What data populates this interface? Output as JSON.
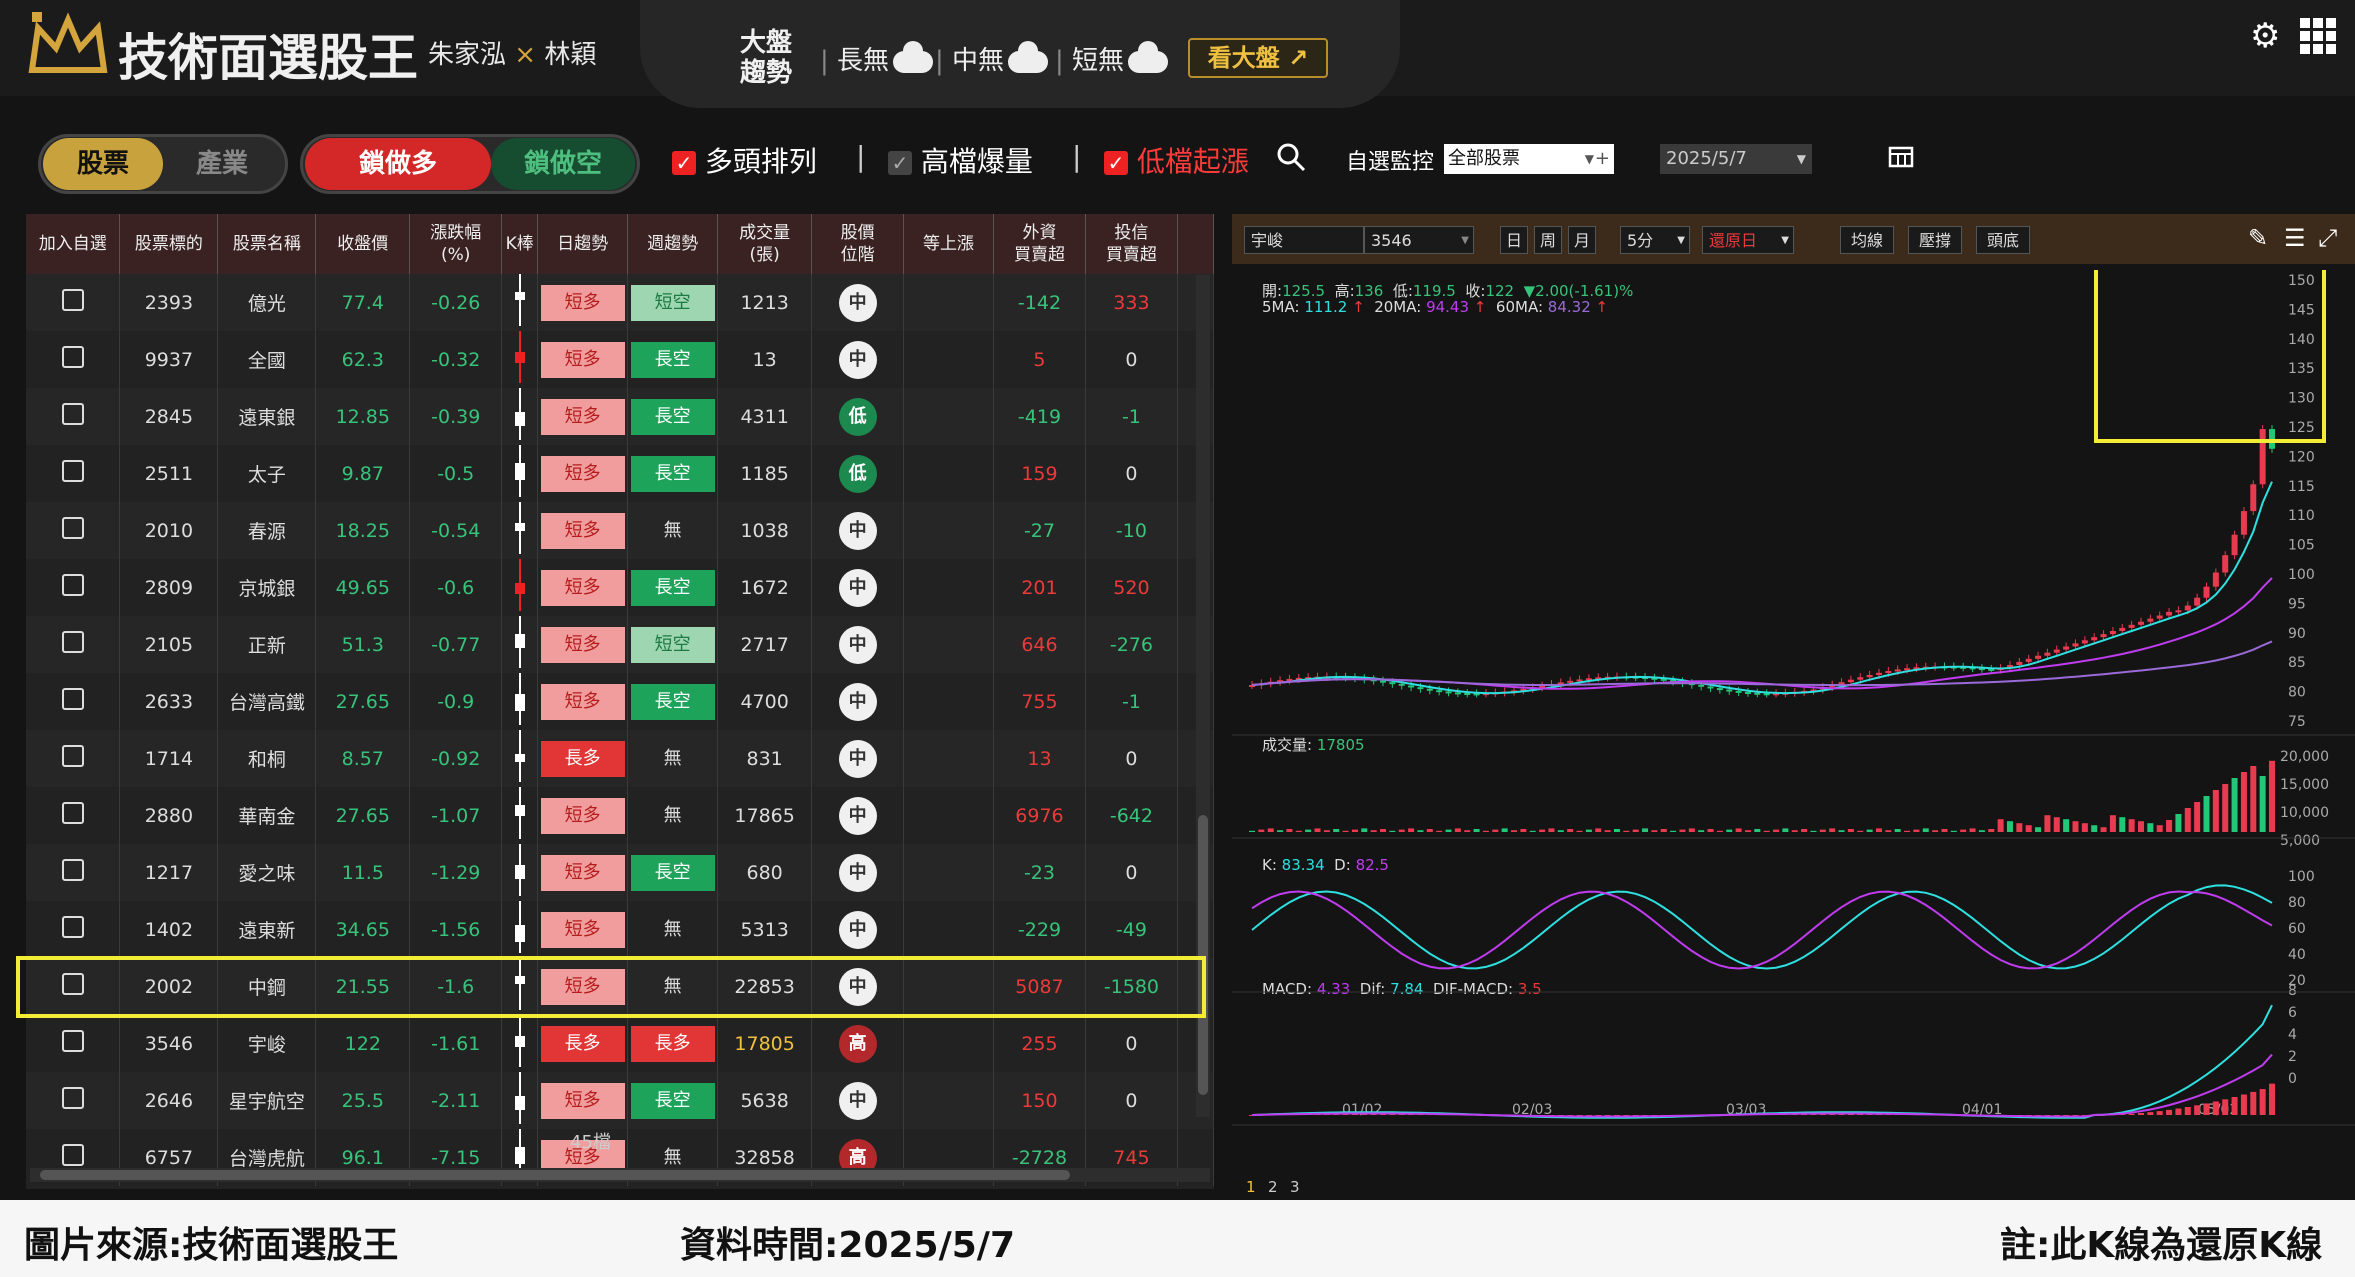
{
  "header": {
    "title": "技術面選股王",
    "author1": "朱家泓",
    "author_sep": "×",
    "author2": "林穎",
    "market_label_top": "大盤",
    "market_label_bottom": "趨勢",
    "long": "長無",
    "mid": "中無",
    "short": "短無",
    "see_market": "看大盤"
  },
  "toolbar": {
    "tab_stock": "股票",
    "tab_industry": "產業",
    "lock_long": "鎖做多",
    "lock_short": "鎖做空",
    "opt1": "多頭排列",
    "opt2": "高檔爆量",
    "opt3": "低檔起漲",
    "watch_label": "自選監控",
    "watch_select": "全部股票",
    "date": "2025/5/7"
  },
  "table": {
    "headers": [
      "加入自選",
      "股票標的",
      "股票名稱",
      "收盤價",
      "漲跌幅\n(%)",
      "K棒",
      "日趨勢",
      "週趨勢",
      "成交量\n(張)",
      "股價\n位階",
      "等上漲",
      "外資\n買賣超",
      "投信\n買賣超"
    ],
    "rows": [
      {
        "code": "2393",
        "name": "億光",
        "close": "77.4",
        "chg": "-0.26",
        "day": "短多",
        "week": "短空",
        "vol": "1213",
        "pos": "中",
        "fi": "-142",
        "it": "333"
      },
      {
        "code": "9937",
        "name": "全國",
        "close": "62.3",
        "chg": "-0.32",
        "day": "短多",
        "week": "長空",
        "vol": "13",
        "pos": "中",
        "fi": "5",
        "it": "0"
      },
      {
        "code": "2845",
        "name": "遠東銀",
        "close": "12.85",
        "chg": "-0.39",
        "day": "短多",
        "week": "長空",
        "vol": "4311",
        "pos": "低",
        "fi": "-419",
        "it": "-1"
      },
      {
        "code": "2511",
        "name": "太子",
        "close": "9.87",
        "chg": "-0.5",
        "day": "短多",
        "week": "長空",
        "vol": "1185",
        "pos": "低",
        "fi": "159",
        "it": "0"
      },
      {
        "code": "2010",
        "name": "春源",
        "close": "18.25",
        "chg": "-0.54",
        "day": "短多",
        "week": "無",
        "vol": "1038",
        "pos": "中",
        "fi": "-27",
        "it": "-10"
      },
      {
        "code": "2809",
        "name": "京城銀",
        "close": "49.65",
        "chg": "-0.6",
        "day": "短多",
        "week": "長空",
        "vol": "1672",
        "pos": "中",
        "fi": "201",
        "it": "520"
      },
      {
        "code": "2105",
        "name": "正新",
        "close": "51.3",
        "chg": "-0.77",
        "day": "短多",
        "week": "短空",
        "vol": "2717",
        "pos": "中",
        "fi": "646",
        "it": "-276"
      },
      {
        "code": "2633",
        "name": "台灣高鐵",
        "close": "27.65",
        "chg": "-0.9",
        "day": "短多",
        "week": "長空",
        "vol": "4700",
        "pos": "中",
        "fi": "755",
        "it": "-1"
      },
      {
        "code": "1714",
        "name": "和桐",
        "close": "8.57",
        "chg": "-0.92",
        "day": "長多",
        "week": "無",
        "vol": "831",
        "pos": "中",
        "fi": "13",
        "it": "0"
      },
      {
        "code": "2880",
        "name": "華南金",
        "close": "27.65",
        "chg": "-1.07",
        "day": "短多",
        "week": "無",
        "vol": "17865",
        "pos": "中",
        "fi": "6976",
        "it": "-642"
      },
      {
        "code": "1217",
        "name": "愛之味",
        "close": "11.5",
        "chg": "-1.29",
        "day": "短多",
        "week": "長空",
        "vol": "680",
        "pos": "中",
        "fi": "-23",
        "it": "0"
      },
      {
        "code": "1402",
        "name": "遠東新",
        "close": "34.65",
        "chg": "-1.56",
        "day": "短多",
        "week": "無",
        "vol": "5313",
        "pos": "中",
        "fi": "-229",
        "it": "-49"
      },
      {
        "code": "2002",
        "name": "中鋼",
        "close": "21.55",
        "chg": "-1.6",
        "day": "短多",
        "week": "無",
        "vol": "22853",
        "pos": "中",
        "fi": "5087",
        "it": "-1580"
      },
      {
        "code": "3546",
        "name": "宇峻",
        "close": "122",
        "chg": "-1.61",
        "day": "長多",
        "week": "長多",
        "vol": "17805",
        "pos": "高",
        "fi": "255",
        "it": "0"
      },
      {
        "code": "2646",
        "name": "星宇航空",
        "close": "25.5",
        "chg": "-2.11",
        "day": "短多",
        "week": "長空",
        "vol": "5638",
        "pos": "中",
        "fi": "150",
        "it": "0"
      },
      {
        "code": "6757",
        "name": "台灣虎航",
        "close": "96.1",
        "chg": "-7.15",
        "day": "短多",
        "week": "無",
        "vol": "32858",
        "pos": "高",
        "fi": "-2728",
        "it": "745"
      }
    ],
    "count": "45檔"
  },
  "chart_panel": {
    "stock_name": "宇峻",
    "stock_code": "3546",
    "btn_day": "日",
    "btn_week": "周",
    "btn_month": "月",
    "interval": "5分",
    "restore": "還原日",
    "btn_ma": "均線",
    "btn_pressure": "壓撐",
    "btn_head": "頭底",
    "ohlc": {
      "open_label": "開:",
      "open": "125.5",
      "high_label": "高:",
      "high": "136",
      "low_label": "低:",
      "low": "119.5",
      "close_label": "收:",
      "close": "122",
      "chg": "▼2.00(-1.61)%"
    },
    "ma": {
      "ma5_label": "5MA:",
      "ma5": "111.2",
      "ma20_label": "20MA:",
      "ma20": "94.43",
      "ma60_label": "60MA:",
      "ma60": "84.32"
    },
    "vol_label": "成交量:",
    "vol_value": "17805",
    "k_label": "K:",
    "k_value": "83.34",
    "d_label": "D:",
    "d_value": "82.5",
    "macd_label": "MACD:",
    "macd_value": "4.33",
    "dif_label": "Dif:",
    "dif_value": "7.84",
    "difmacd_label": "DIF-MACD:",
    "difmacd_value": "3.5",
    "price_ticks": [
      "150",
      "145",
      "140",
      "135",
      "130",
      "125",
      "120",
      "115",
      "110",
      "105",
      "100",
      "95",
      "90",
      "85",
      "80",
      "75"
    ],
    "vol_ticks": [
      "20,000",
      "15,000",
      "10,000",
      "5,000"
    ],
    "kd_ticks": [
      "100",
      "80",
      "60",
      "40",
      "20"
    ],
    "macd_ticks": [
      "8",
      "6",
      "4",
      "2",
      "0"
    ],
    "date_ticks": [
      "01/02",
      "02/03",
      "03/03",
      "04/01",
      "05/02"
    ],
    "pages": [
      "1",
      "2",
      "3"
    ],
    "colors": {
      "ma5": "#2ee0e0",
      "ma20": "#c03cf0",
      "ma60": "#c03cf0",
      "up": "#ea3a50",
      "down": "#22c778"
    }
  },
  "footer": {
    "source": "圖片來源:技術面選股王",
    "time": "資料時間:2025/5/7",
    "note": "註:此K線為還原K線"
  }
}
